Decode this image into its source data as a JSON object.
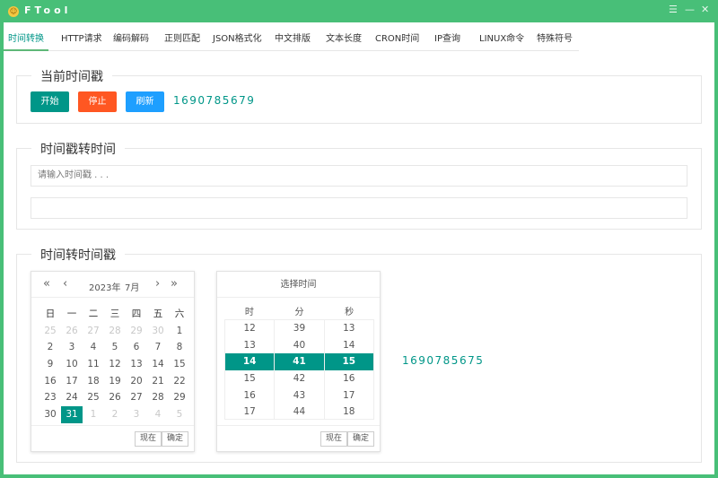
{
  "window": {
    "title": "FTool",
    "menu_icon": "menu-icon",
    "minimize_icon": "minimize-icon",
    "close_icon": "close-icon"
  },
  "tabs": [
    "时间转换",
    "HTTP请求",
    "编码解码",
    "正则匹配",
    "JSON格式化",
    "中文排版",
    "文本长度",
    "CRON时间",
    "IP查询",
    "LINUX命令",
    "特殊符号"
  ],
  "current_ts": {
    "legend": "当前时间戳",
    "start": "开始",
    "stop": "停止",
    "refresh": "刷新",
    "value": "1690785679"
  },
  "ts_to_time": {
    "legend": "时间戳转时间",
    "placeholder": "请输入时间戳 . . .",
    "output": ""
  },
  "time_to_ts": {
    "legend": "时间转时间戳",
    "result": "1690785675",
    "calendar": {
      "year": "2023年",
      "month": "7月",
      "weekdays": [
        "日",
        "一",
        "二",
        "三",
        "四",
        "五",
        "六"
      ],
      "days": [
        [
          "25",
          "26",
          "27",
          "28",
          "29",
          "30",
          "1"
        ],
        [
          "2",
          "3",
          "4",
          "5",
          "6",
          "7",
          "8"
        ],
        [
          "9",
          "10",
          "11",
          "12",
          "13",
          "14",
          "15"
        ],
        [
          "16",
          "17",
          "18",
          "19",
          "20",
          "21",
          "22"
        ],
        [
          "23",
          "24",
          "25",
          "26",
          "27",
          "28",
          "29"
        ],
        [
          "30",
          "31",
          "1",
          "2",
          "3",
          "4",
          "5"
        ]
      ],
      "selected_day": "31",
      "now": "现在",
      "confirm": "确定"
    },
    "time_picker": {
      "title": "选择时间",
      "headers": [
        "时",
        "分",
        "秒"
      ],
      "hours": [
        "12",
        "13",
        "14",
        "15",
        "16",
        "17"
      ],
      "minutes": [
        "39",
        "40",
        "41",
        "42",
        "43",
        "44"
      ],
      "seconds": [
        "13",
        "14",
        "15",
        "16",
        "17",
        "18"
      ],
      "selected": [
        "14",
        "41",
        "15"
      ],
      "now": "现在",
      "confirm": "确定"
    }
  },
  "colors": {
    "accent": "#009688",
    "title_bar": "#48bf78",
    "stop": "#ff5722",
    "refresh": "#1e9fff"
  }
}
